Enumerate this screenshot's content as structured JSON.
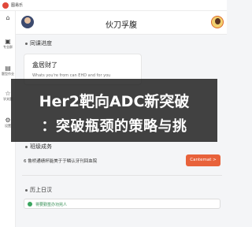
{
  "app": {
    "name": "图易乐"
  },
  "rail": {
    "items": [
      {
        "icon": "⌂",
        "label": ""
      },
      {
        "icon": "▣",
        "label": "专业群"
      },
      {
        "icon": "▤",
        "label": "题型作业"
      },
      {
        "icon": "☆",
        "label": "学关题"
      },
      {
        "icon": "⚙",
        "label": "设置"
      }
    ]
  },
  "header": {
    "title": "伙刀孚腹"
  },
  "sections": {
    "top": "同课进度",
    "middle": "班级成务",
    "bottom": "历上日汉"
  },
  "card": {
    "title": "盒居财了",
    "subtitle": "Whats you're from can EHD and for you"
  },
  "banner": {
    "line1": "Her2靶向ADC新突破",
    "line2": "：突破瓶颈的策略与挑"
  },
  "task_row": {
    "text": "6 鲁桥通绩杯能美于于鳞认牙刊回血院",
    "button": "Cantemat >"
  },
  "pill": {
    "text": "将要勤签办功完人"
  }
}
